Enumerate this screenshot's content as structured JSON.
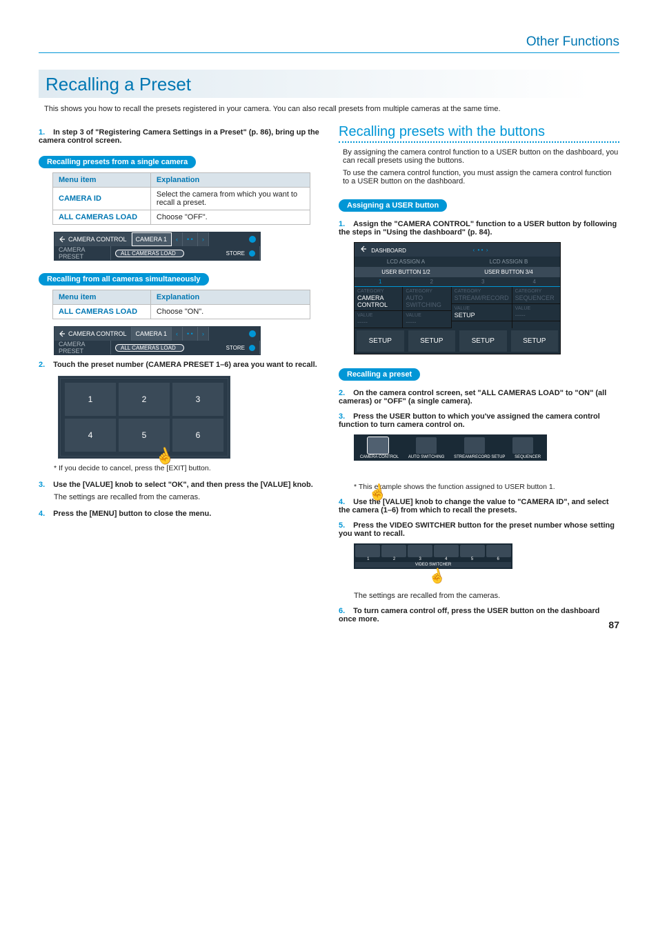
{
  "header": {
    "section": "Other Functions"
  },
  "title": "Recalling a Preset",
  "intro": "This shows you how to recall the presets registered in your camera. You can also recall presets from multiple cameras at the same time.",
  "left": {
    "step1": {
      "num": "1.",
      "text": "In step 3 of \"Registering Camera Settings in a Preset\" (p. 86), bring up the camera control screen."
    },
    "pill_single": "Recalling presets from a single camera",
    "table1": {
      "head_menu": "Menu item",
      "head_expl": "Explanation",
      "rows": [
        {
          "k": "CAMERA ID",
          "v": "Select the camera from which you want to recall a preset."
        },
        {
          "k": "ALL CAMERAS LOAD",
          "v": "Choose \"OFF\"."
        }
      ]
    },
    "ccbar1": {
      "back": "CAMERA CONTROL",
      "cam": "CAMERA 1",
      "preset_label": "CAMERA PRESET",
      "allcam": "ALL CAMERAS LOAD",
      "store": "STORE"
    },
    "pill_all": "Recalling from all cameras simultaneously",
    "table2": {
      "head_menu": "Menu item",
      "head_expl": "Explanation",
      "rows": [
        {
          "k": "ALL CAMERAS LOAD",
          "v": "Choose \"ON\"."
        }
      ]
    },
    "ccbar2": {
      "back": "CAMERA CONTROL",
      "cam": "CAMERA 1",
      "preset_label": "CAMERA PRESET",
      "allcam": "ALL CAMERAS LOAD",
      "store": "STORE"
    },
    "step2": {
      "num": "2.",
      "text": "Touch the preset number (CAMERA PRESET 1–6) area you want to recall."
    },
    "presets": [
      "1",
      "2",
      "3",
      "4",
      "5",
      "6"
    ],
    "note_cancel": "*  If you decide to cancel, press the [EXIT] button.",
    "step3": {
      "num": "3.",
      "text": "Use the [VALUE] knob to select \"OK\", and then press the [VALUE] knob.",
      "sub": "The settings are recalled from the cameras."
    },
    "step4": {
      "num": "4.",
      "text": "Press the [MENU] button to close the menu."
    }
  },
  "right": {
    "subtitle": "Recalling presets with the buttons",
    "para1": "By assigning the camera control function to a USER button on the dashboard, you can recall presets using the buttons.",
    "para2": "To use the camera control function, you must assign the camera control function to a USER button on the dashboard.",
    "pill_assign": "Assigning a USER button",
    "step1": {
      "num": "1.",
      "text": "Assign the \"CAMERA CONTROL\" function to a USER button by following the steps in \"Using the dashboard\" (p. 84)."
    },
    "dash": {
      "back": "DASHBOARD",
      "lcd_a": "LCD ASSIGN A",
      "lcd_b": "LCD ASSIGN B",
      "tab12": "USER BUTTON 1/2",
      "tab34": "USER BUTTON 3/4",
      "nums": [
        "1",
        "2",
        "3",
        "4"
      ],
      "cat_label": "CATEGORY",
      "val_label": "VALUE",
      "cats": [
        "CAMERA CONTROL",
        "AUTO SWITCHING",
        "STREAM/RECORD",
        "SEQUENCER"
      ],
      "vals": [
        "-----",
        "-----",
        "SETUP",
        "-----"
      ],
      "setup": "SETUP"
    },
    "pill_recall": "Recalling a preset",
    "step2": {
      "num": "2.",
      "text": "On the camera control screen, set \"ALL CAMERAS LOAD\" to \"ON\" (all cameras) or \"OFF\" (a single camera)."
    },
    "step3": {
      "num": "3.",
      "text": "Press the USER button to which you've assigned the camera control function to turn camera control on."
    },
    "ub": {
      "labels": [
        "CAMERA CONTROL",
        "AUTO SWITCHING",
        "STREAM/RECORD SETUP",
        "SEQUENCER"
      ]
    },
    "note_example": "*  This example shows the function assigned to USER button 1.",
    "step4": {
      "num": "4.",
      "text": "Use the [VALUE] knob to change the value to \"CAMERA ID\", and select the camera (1–6) from which to recall the presets."
    },
    "step5": {
      "num": "5.",
      "text": "Press the VIDEO SWITCHER button for the preset number whose setting you want to recall.",
      "sub": "The settings are recalled from the cameras."
    },
    "vs": {
      "nums": [
        "1",
        "2",
        "3",
        "4",
        "5",
        "6"
      ],
      "label": "VIDEO SWITCHER"
    },
    "step6": {
      "num": "6.",
      "text": "To turn camera control off, press the USER button on the dashboard once more."
    }
  },
  "page_number": "87"
}
